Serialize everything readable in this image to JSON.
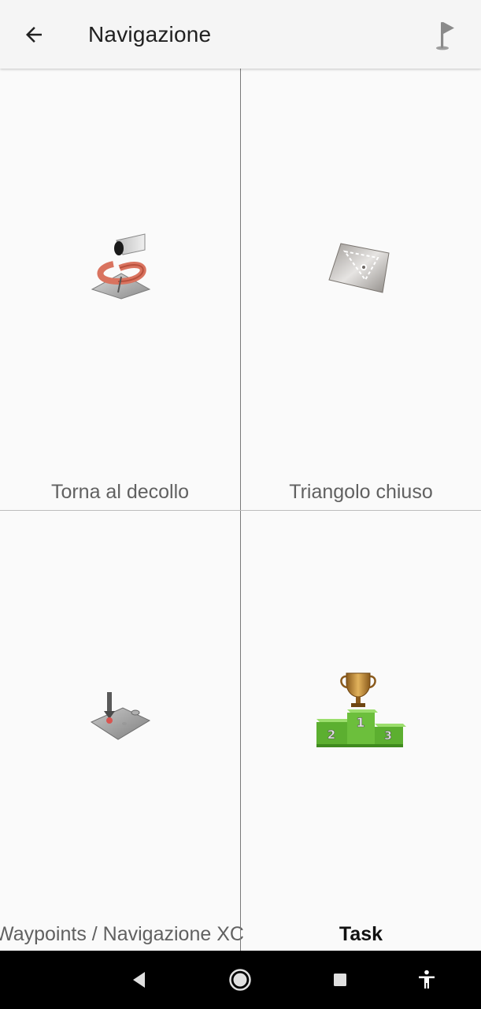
{
  "appbar": {
    "title": "Navigazione",
    "back_icon": "arrow-left-icon",
    "action_icon": "flag-icon"
  },
  "tiles": [
    {
      "label": "Torna al decollo",
      "icon": "return-to-takeoff-icon"
    },
    {
      "label": "Triangolo chiuso",
      "icon": "closed-triangle-icon"
    },
    {
      "label": "Waypoints / Navigazione XC",
      "icon": "waypoints-icon"
    },
    {
      "label": "Task",
      "icon": "trophy-podium-icon"
    }
  ],
  "system_nav": {
    "back": "nav-back-icon",
    "home": "nav-home-icon",
    "recents": "nav-recents-icon",
    "accessibility": "accessibility-icon"
  },
  "colors": {
    "appbar_bg": "#f5f5f5",
    "page_bg": "#fafafa",
    "label_text": "#616161",
    "podium_green": "#6cbf3c",
    "trophy_gold": "#b8862b",
    "spiral_red": "#d9735f"
  }
}
